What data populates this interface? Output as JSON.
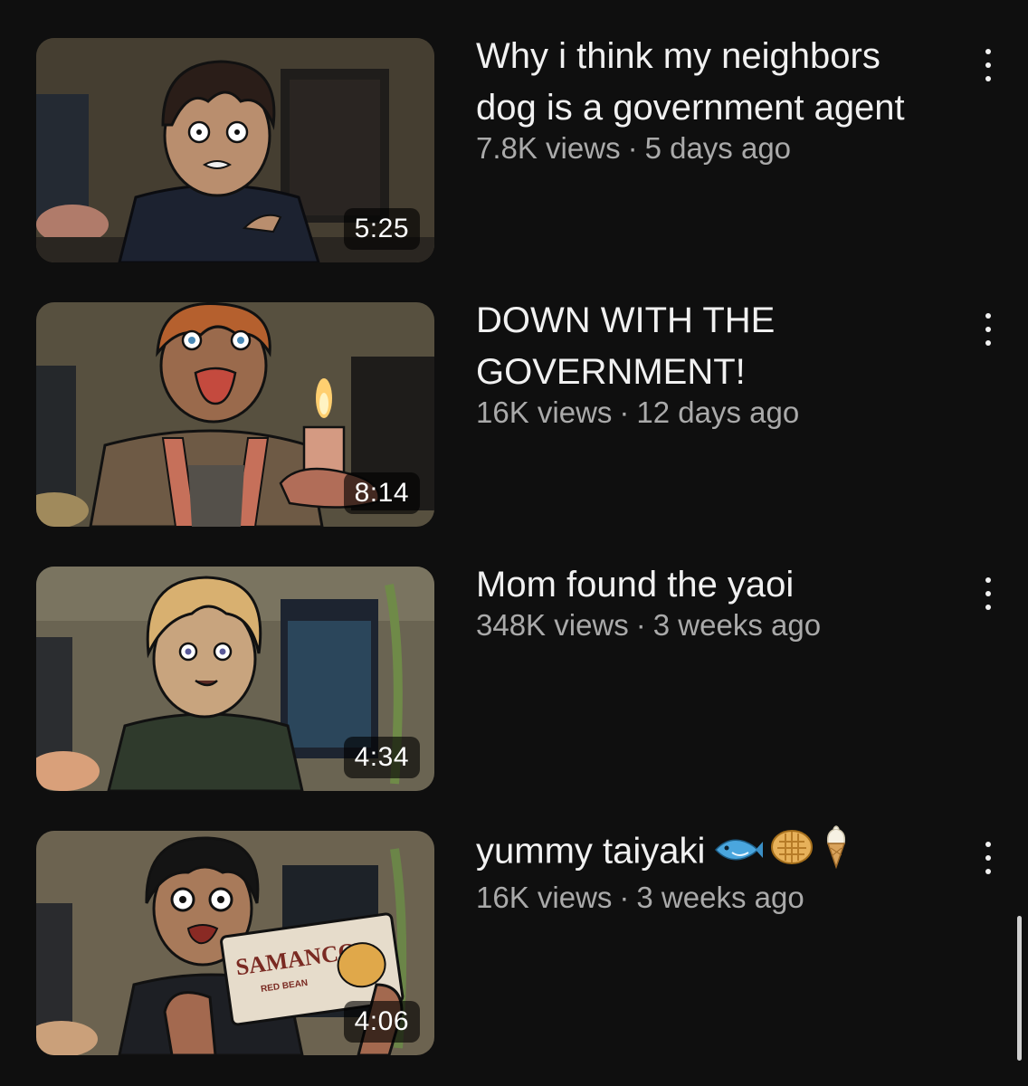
{
  "videos": [
    {
      "title": "Why i think my neighbors dog is a government agent",
      "views": "7.8K views",
      "age": "5 days ago",
      "duration": "5:25",
      "thumb_colors": {
        "wall": "#4a4334",
        "shirt": "#1c2230",
        "hair": "#2a1d18",
        "skin": "#b98e6e"
      }
    },
    {
      "title": "DOWN WITH THE GOVERNMENT!",
      "views": "16K views",
      "age": "12 days ago",
      "duration": "8:14",
      "thumb_colors": {
        "wall": "#57503f",
        "shirt": "#6e5a45",
        "hair": "#b5602e",
        "skin": "#9a6a4c"
      }
    },
    {
      "title": "Mom found the yaoi",
      "views": "348K views",
      "age": "3 weeks ago",
      "duration": "4:34",
      "thumb_colors": {
        "wall": "#6a6452",
        "shirt": "#2f3a2c",
        "hair": "#d8b070",
        "skin": "#c8a47e"
      }
    },
    {
      "title": "yummy taiyaki",
      "title_emojis": [
        "fish-emoji",
        "waffle-emoji",
        "ice-cream-emoji"
      ],
      "views": "16K views",
      "age": "3 weeks ago",
      "duration": "4:06",
      "thumb_colors": {
        "wall": "#6c6350",
        "shirt": "#1d1f24",
        "hair": "#141414",
        "skin": "#a87a5a"
      },
      "package_text": "SAMANCO",
      "package_small": "RED BEAN"
    }
  ],
  "separator": "·"
}
